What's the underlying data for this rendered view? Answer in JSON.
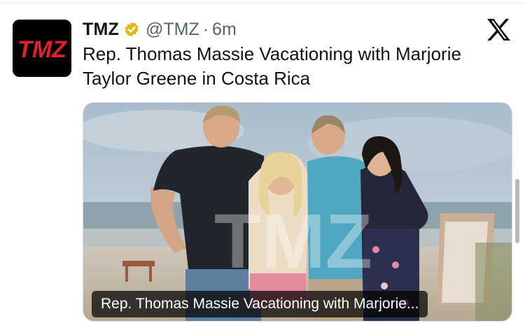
{
  "tweet": {
    "avatar_logo": "TMZ",
    "display_name": "TMZ",
    "verified_badge": "gold-verified-badge-icon",
    "handle": "@TMZ",
    "separator": "·",
    "time": "6m",
    "text": "Rep. Thomas Massie Vacationing with Marjorie Taylor Greene in Costa Rica"
  },
  "media": {
    "watermark": "TMZ",
    "caption": "Rep. Thomas Massie Vacationing with Marjorie..."
  },
  "icons": {
    "platform_logo": "x-logo-icon"
  },
  "colors": {
    "text": "#0f1419",
    "secondary_text": "#536471",
    "tmz_red": "#e0202a",
    "verified_gold": "#e2b719"
  }
}
